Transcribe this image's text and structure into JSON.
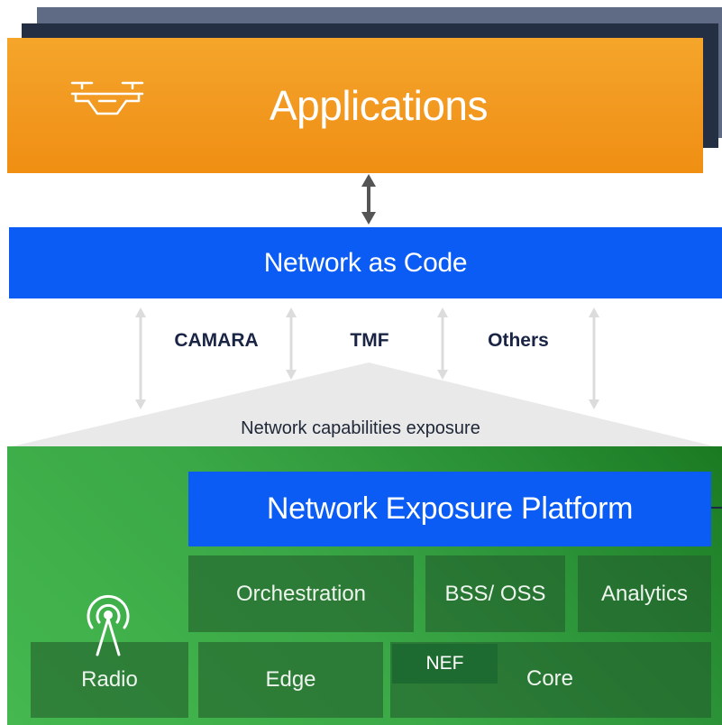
{
  "applications": {
    "title": "Applications",
    "icon": "drone-icon"
  },
  "network_as_code": {
    "title": "Network as Code"
  },
  "standards": {
    "camara": "CAMARA",
    "tmf": "TMF",
    "others": "Others"
  },
  "exposure_label": "Network capabilities exposure",
  "platform": {
    "title": "Network Exposure Platform",
    "orchestration": "Orchestration",
    "bss_oss": "BSS/ OSS",
    "analytics": "Analytics"
  },
  "network": {
    "radio": "Radio",
    "radio_icon": "antenna-icon",
    "edge": "Edge",
    "nef": "NEF",
    "core": "Core"
  },
  "colors": {
    "applications_orange": "#f29a22",
    "accent_blue": "#0a5cf5",
    "network_green": "#3aa846",
    "stack_dark": "#242f44"
  }
}
